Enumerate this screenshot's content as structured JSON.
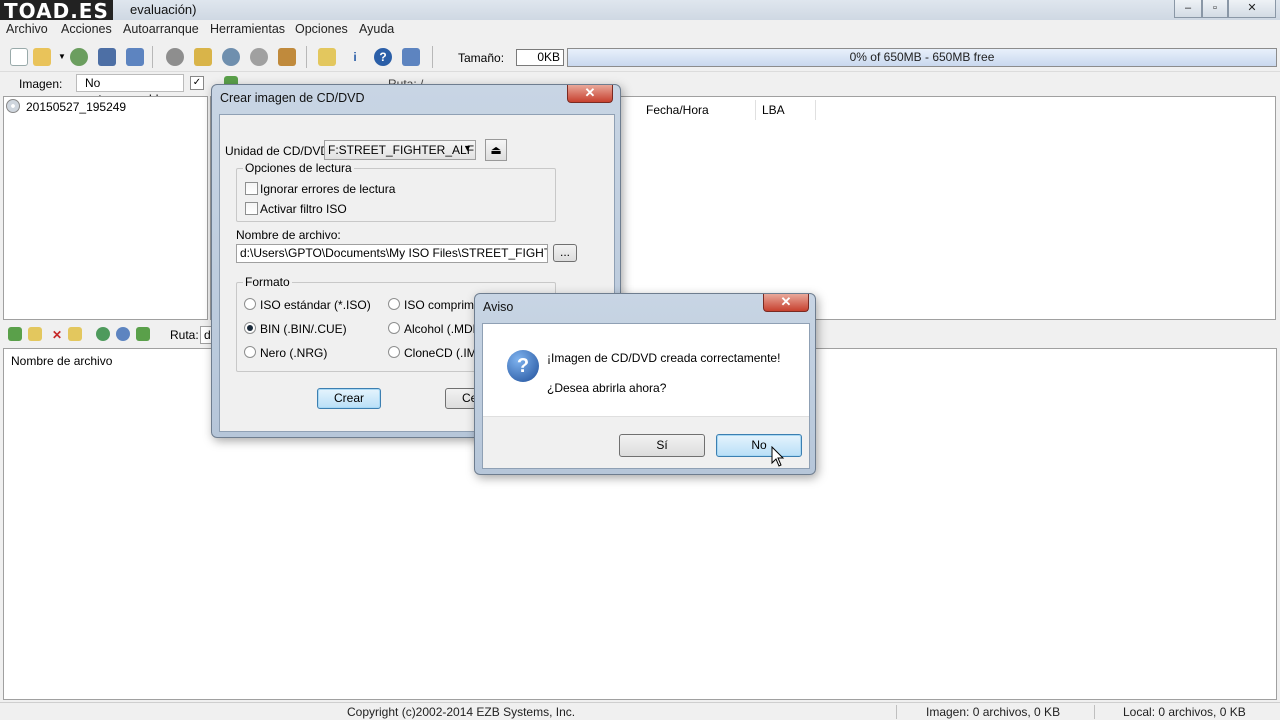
{
  "app": {
    "logo": "TOAD.ES",
    "title_fragment": "evaluación)",
    "window_buttons": [
      "–",
      "▫",
      "✕"
    ]
  },
  "menu": [
    "Archivo",
    "Acciones",
    "Autoarranque",
    "Herramientas",
    "Opciones",
    "Ayuda"
  ],
  "toolbar": {
    "size_label": "Tamaño:",
    "size_value": "0KB",
    "progress_text": "0% of 650MB - 650MB free",
    "progress_fraction": 0
  },
  "image_bar": {
    "label": "Imagen:",
    "boot_value": "No autoarrancable",
    "path_label": "Ruta: /"
  },
  "tree": {
    "root_item": "20150527_195249"
  },
  "upper_columns": [
    "Fecha/Hora",
    "LBA"
  ],
  "lower": {
    "path_label": "Ruta:",
    "path_value": "d:",
    "column": "Nombre de archivo"
  },
  "status": {
    "copyright": "Copyright (c)2002-2014 EZB Systems, Inc.",
    "image_info": "Imagen: 0 archivos, 0 KB",
    "local_info": "Local: 0 archivos, 0 KB"
  },
  "create_dialog": {
    "title": "Crear imagen de CD/DVD",
    "drive_label": "Unidad de CD/DVD:",
    "drive_value": "F:STREET_FIGHTER_ALF",
    "read_options_label": "Opciones de lectura",
    "ignore_errors": "Ignorar errores de lectura",
    "iso_filter": "Activar filtro ISO",
    "filename_label": "Nombre de archivo:",
    "filename_value": "d:\\Users\\GPTO\\Documents\\My ISO Files\\STREET_FIGHTER_A",
    "browse": "...",
    "format_label": "Formato",
    "formats": {
      "iso": "ISO estándar (*.ISO)",
      "bin": "BIN (.BIN/.CUE)",
      "nrg": "Nero (.NRG)",
      "compressed": "ISO comprimid",
      "alcohol": "Alcohol (.MDF/",
      "clonecd": "CloneCD (.IMG"
    },
    "create_btn": "Crear",
    "cancel_btn": "Ce"
  },
  "notice_dialog": {
    "title": "Aviso",
    "message1": "¡Imagen de CD/DVD creada correctamente!",
    "message2": "¿Desea abrirla ahora?",
    "yes": "Sí",
    "no": "No"
  }
}
